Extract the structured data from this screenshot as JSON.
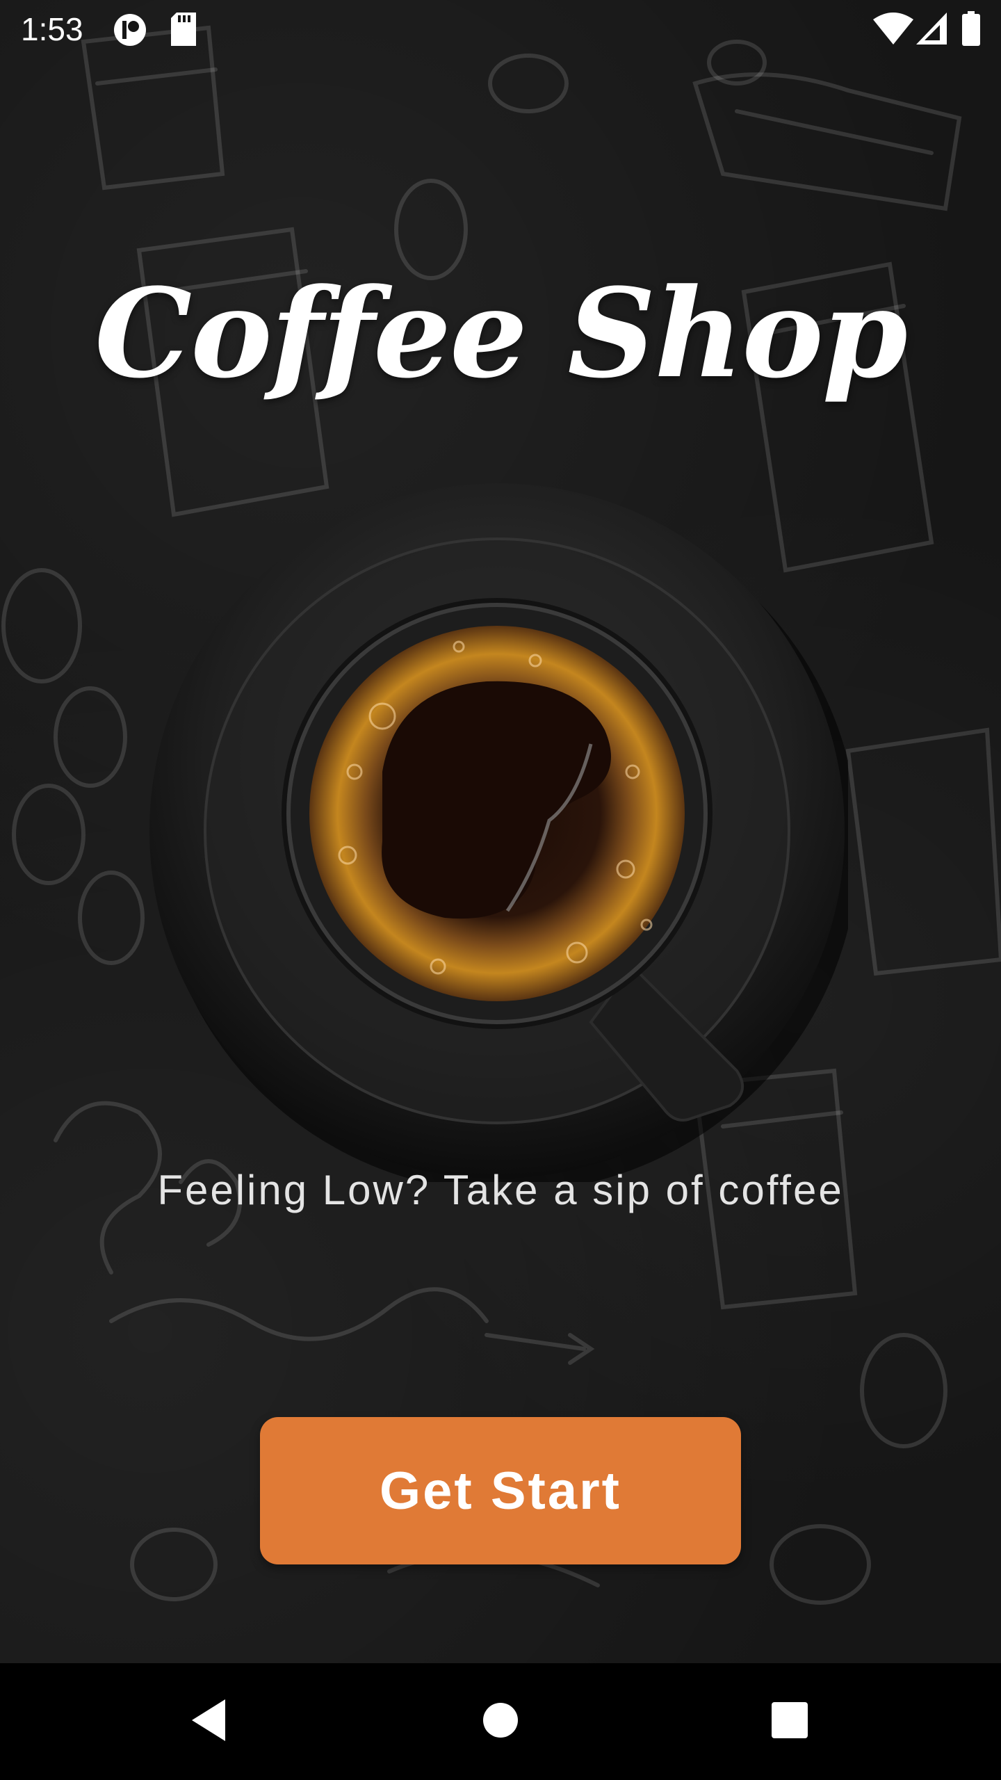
{
  "status_bar": {
    "time": "1:53",
    "icons": [
      "record-icon",
      "sd-card-icon",
      "wifi-icon",
      "signal-icon",
      "battery-icon"
    ]
  },
  "app": {
    "title": "Coffee Shop",
    "tagline": "Feeling Low? Take a sip of coffee",
    "start_label": "Get Start"
  },
  "nav_bar": {
    "icons": [
      "back-icon",
      "home-icon",
      "recents-icon"
    ]
  },
  "colors": {
    "accent": "#e07a36",
    "background": "#161616",
    "text": "#ffffff"
  }
}
